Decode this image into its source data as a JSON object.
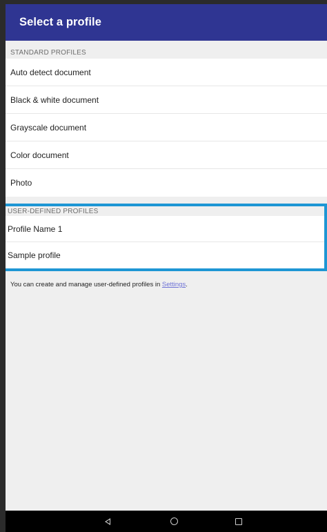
{
  "appbar": {
    "title": "Select a profile"
  },
  "standard_profiles": {
    "header": "STANDARD PROFILES",
    "items": [
      {
        "label": "Auto detect document"
      },
      {
        "label": "Black & white document"
      },
      {
        "label": "Grayscale document"
      },
      {
        "label": "Color document"
      },
      {
        "label": "Photo"
      }
    ]
  },
  "user_profiles": {
    "header": "USER-DEFINED PROFILES",
    "items": [
      {
        "label": "Profile Name 1"
      },
      {
        "label": "Sample profile"
      }
    ],
    "highlight_color": "#1e96d4"
  },
  "footer_note": {
    "text": "You can create and manage user-defined profiles in ",
    "link": "Settings",
    "suffix": "."
  },
  "navbar": {
    "icons": [
      "back-icon",
      "home-icon",
      "recent-apps-icon"
    ]
  },
  "colors": {
    "appbar": "#2f3592",
    "background": "#efefef"
  }
}
